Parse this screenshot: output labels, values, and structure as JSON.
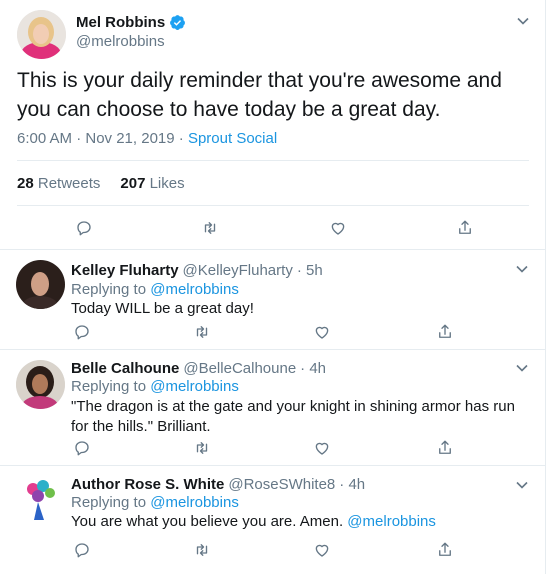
{
  "main_tweet": {
    "author_name": "Mel Robbins",
    "handle": "@melrobbins",
    "text": "This is your daily reminder that you're awesome and you can choose to have today be a great day.",
    "time": "6:00 AM · Nov 21, 2019",
    "separator": "·",
    "source": "Sprout Social",
    "retweets_count": "28",
    "retweets_label": "Retweets",
    "likes_count": "207",
    "likes_label": "Likes"
  },
  "replies": [
    {
      "author_name": "Kelley Fluharty",
      "handle": "@KelleyFluharty",
      "time": "· 5h",
      "replying_prefix": "Replying to",
      "replying_to": "@melrobbins",
      "text": "Today WILL be a great day!"
    },
    {
      "author_name": "Belle Calhoune",
      "handle": "@BelleCalhoune",
      "time": "· 4h",
      "replying_prefix": "Replying to",
      "replying_to": "@melrobbins",
      "text": "\"The dragon is at the gate and your knight in shining armor has run for the hills.\" Brilliant."
    },
    {
      "author_name": "Author Rose S. White",
      "handle": "@RoseSWhite8",
      "time": "· 4h",
      "replying_prefix": "Replying to",
      "replying_to": "@melrobbins",
      "text": "You are what you believe you are. Amen.",
      "trailing_mention": "@melrobbins"
    }
  ],
  "colors": {
    "accent": "#1b95e0",
    "muted": "#657786",
    "text": "#14171a",
    "divider": "#e6ecf0",
    "verified": "#1da1f2"
  },
  "icons": [
    "reply-icon",
    "retweet-icon",
    "like-icon",
    "share-icon",
    "chevron-down-icon",
    "verified-icon"
  ]
}
